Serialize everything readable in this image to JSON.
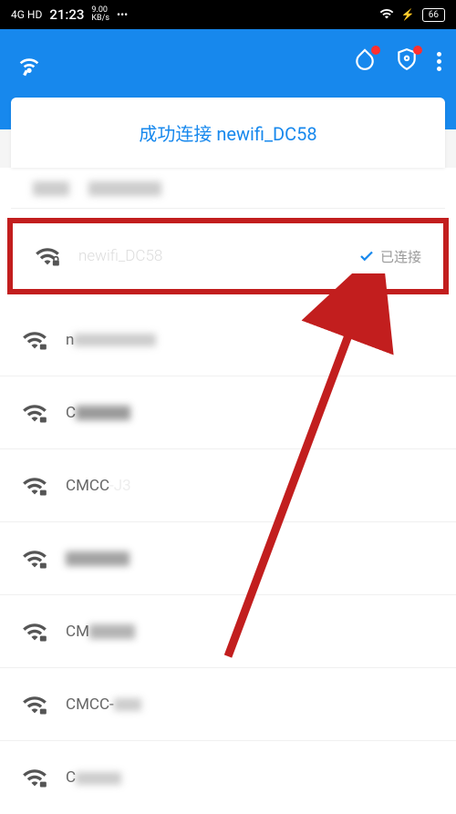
{
  "statusBar": {
    "signal": "4G HD",
    "time": "21:23",
    "speed": "9.00",
    "speedUnit": "KB/s",
    "battery": "66"
  },
  "successBanner": {
    "text": "成功连接 newifi_DC58"
  },
  "wifiList": [
    {
      "name": "",
      "blurred": true,
      "connected": false
    },
    {
      "name": "newifi_DC58",
      "blurred": true,
      "connected": true,
      "connectedLabel": "已连接",
      "highlighted": true
    },
    {
      "name": "newifi5G_DC58",
      "blurred": true,
      "connected": false
    },
    {
      "name": "C",
      "blurred": true,
      "connected": false
    },
    {
      "name": "CMCC",
      "blurred": false,
      "partial": "J3",
      "connected": false
    },
    {
      "name": "",
      "blurred": true,
      "connected": false
    },
    {
      "name": "CM",
      "blurred": true,
      "connected": false
    },
    {
      "name": "CMCC-",
      "blurred": true,
      "connected": false
    },
    {
      "name": "C",
      "blurred": true,
      "connected": false
    }
  ]
}
